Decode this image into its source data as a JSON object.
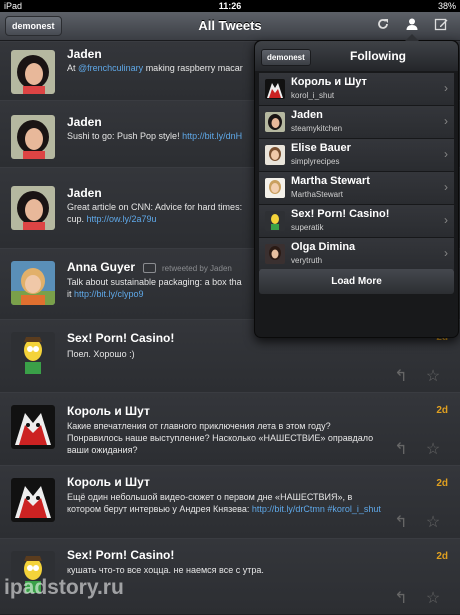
{
  "status": {
    "device": "iPad",
    "time": "11:26",
    "battery": "38%"
  },
  "nav": {
    "account": "demonest",
    "title": "All Tweets"
  },
  "tweets": [
    {
      "name": "Jaden",
      "text_pre": "At ",
      "mention": "@frenchculinary",
      "text_post": " making raspberry macar",
      "time": "",
      "avatar": "jaden"
    },
    {
      "name": "Jaden",
      "text": "Sushi to go: Push Pop style! ",
      "link": "http://bit.ly/dnH",
      "time": "",
      "avatar": "jaden"
    },
    {
      "name": "Jaden",
      "text": "Great article on CNN: Advice for hard times: cup. ",
      "link": "http://ow.ly/2a79u",
      "time": "",
      "avatar": "jaden"
    },
    {
      "name": "Anna Guyer",
      "retweet": "retweeted by Jaden",
      "text": "Talk about sustainable packaging: a box tha it ",
      "link": "http://bit.ly/clypo9",
      "time": "",
      "avatar": "anna"
    },
    {
      "name": "Sex! Porn! Casino!",
      "text": "Поел. Хорошо :)",
      "time": "2d",
      "avatar": "simpson"
    },
    {
      "name": "Король и Шут",
      "text": "Какие впечатления от главного приключения лета в этом году? Понравилось наше выступление? Насколько «НАШЕСТВИЕ» оправдало ваши ожидания?",
      "time": "2d",
      "avatar": "kish"
    },
    {
      "name": "Король и Шут",
      "text": "Ещё один небольшой видео-сюжет о первом дне «НАШЕСТВИЯ», в котором берут интервью у Андрея Князева: ",
      "link": "http://bit.ly/drCtmn #korol_i_shut",
      "time": "2d",
      "avatar": "kish"
    },
    {
      "name": "Sex! Porn! Casino!",
      "text": "кушать что-то все хоцца. не наемся все с утра.",
      "time": "2d",
      "avatar": "simpson"
    }
  ],
  "popover": {
    "account": "demonest",
    "title": "Following",
    "items": [
      {
        "name": "Король и Шут",
        "handle": "korol_i_shut",
        "avatar": "kish"
      },
      {
        "name": "Jaden",
        "handle": "steamykitchen",
        "avatar": "jaden"
      },
      {
        "name": "Elise Bauer",
        "handle": "simplyrecipes",
        "avatar": "elise"
      },
      {
        "name": "Martha Stewart",
        "handle": "MarthaStewart",
        "avatar": "martha"
      },
      {
        "name": "Sex! Porn! Casino!",
        "handle": "superatik",
        "avatar": "simpson"
      },
      {
        "name": "Olga Dimina",
        "handle": "verytruth",
        "avatar": "olga"
      }
    ],
    "load_more": "Load More"
  },
  "watermark": "ipadstory.ru"
}
